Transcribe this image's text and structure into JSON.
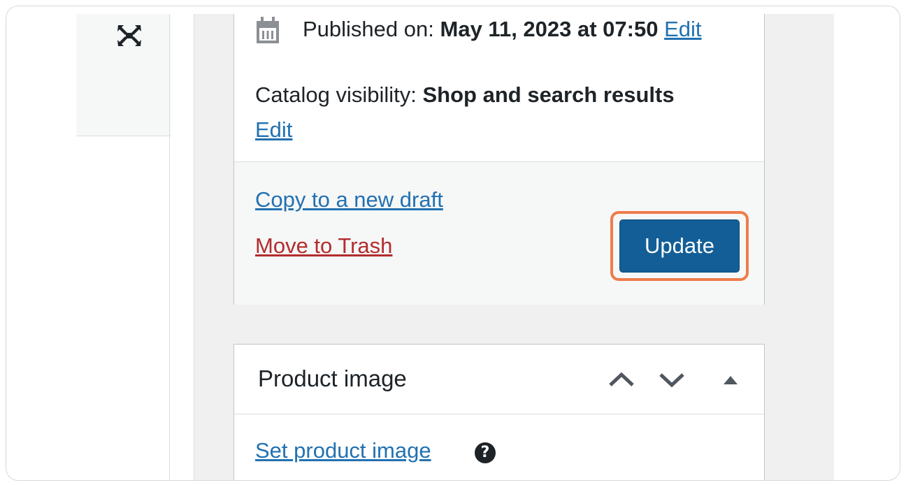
{
  "publish": {
    "published_label": "Published on:",
    "published_date": "May 11, 2023 at 07:50",
    "published_edit": "Edit",
    "visibility_label": "Catalog visibility:",
    "visibility_value": "Shop and search results",
    "visibility_edit": "Edit",
    "copy_draft": "Copy to a new draft",
    "move_trash": "Move to Trash",
    "update_button": "Update"
  },
  "product_image_box": {
    "title": "Product image",
    "set_image_link": "Set product image",
    "help_glyph": "?"
  },
  "icons": {
    "fullscreen": "fullscreen-icon",
    "calendar": "calendar-icon",
    "move_up": "chevron-up-icon",
    "move_down": "chevron-down-icon",
    "toggle": "triangle-up-icon",
    "help": "help-icon"
  },
  "colors": {
    "link": "#2271b1",
    "trash": "#b32d2e",
    "primary_button": "#135e96",
    "highlight": "#ef7c4a",
    "sidebar_bg": "#f0f0f1"
  }
}
